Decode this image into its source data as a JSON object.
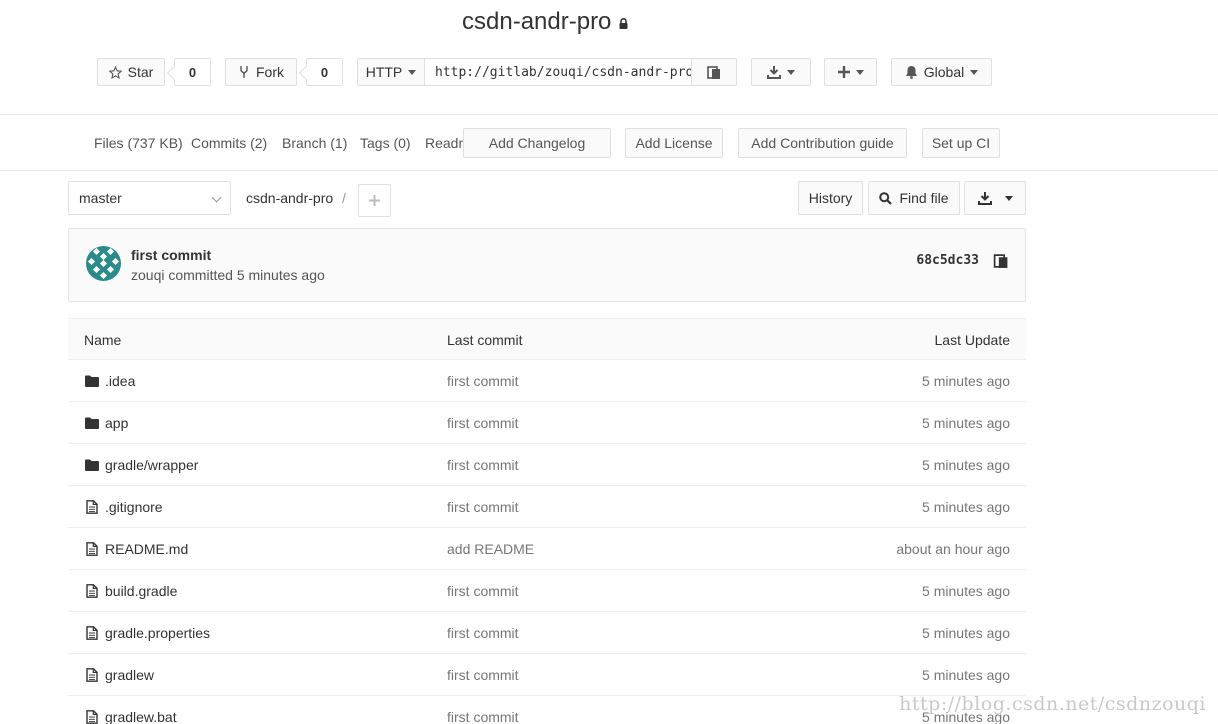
{
  "project": {
    "name": "csdn-andr-pro"
  },
  "actions": {
    "star_label": "Star",
    "star_count": "0",
    "fork_label": "Fork",
    "fork_count": "0",
    "protocol": "HTTP",
    "clone_url": "http://gitlab/zouqi/csdn-andr-pro",
    "notification_level": "Global"
  },
  "nav": {
    "links": [
      "Files (737 KB)",
      "Commits (2)",
      "Branch (1)",
      "Tags (0)",
      "Readme"
    ],
    "buttons": [
      "Add Changelog",
      "Add License",
      "Add Contribution guide",
      "Set up CI"
    ]
  },
  "tree": {
    "branch": "master",
    "breadcrumb": "csdn-andr-pro",
    "breadcrumb_sep": "/",
    "history_label": "History",
    "find_file_label": "Find file"
  },
  "last_commit": {
    "title": "first commit",
    "author": "zouqi",
    "meta": "zouqi committed 5 minutes ago",
    "sha": "68c5dc33"
  },
  "table": {
    "headers": {
      "name": "Name",
      "last_commit": "Last commit",
      "last_update": "Last Update"
    },
    "rows": [
      {
        "type": "folder",
        "name": ".idea",
        "commit": "first commit",
        "updated": "5 minutes ago"
      },
      {
        "type": "folder",
        "name": "app",
        "commit": "first commit",
        "updated": "5 minutes ago"
      },
      {
        "type": "folder",
        "name": "gradle/wrapper",
        "commit": "first commit",
        "updated": "5 minutes ago"
      },
      {
        "type": "file",
        "name": ".gitignore",
        "commit": "first commit",
        "updated": "5 minutes ago"
      },
      {
        "type": "file",
        "name": "README.md",
        "commit": "add README",
        "updated": "about an hour ago"
      },
      {
        "type": "file",
        "name": "build.gradle",
        "commit": "first commit",
        "updated": "5 minutes ago"
      },
      {
        "type": "file",
        "name": "gradle.properties",
        "commit": "first commit",
        "updated": "5 minutes ago"
      },
      {
        "type": "file",
        "name": "gradlew",
        "commit": "first commit",
        "updated": "5 minutes ago"
      },
      {
        "type": "file",
        "name": "gradlew.bat",
        "commit": "first commit",
        "updated": "5 minutes ago"
      }
    ]
  },
  "watermark": "http://blog.csdn.net/csdnzouqi",
  "colors": {
    "avatar": "#2b8a8a",
    "icon": "#333333"
  }
}
